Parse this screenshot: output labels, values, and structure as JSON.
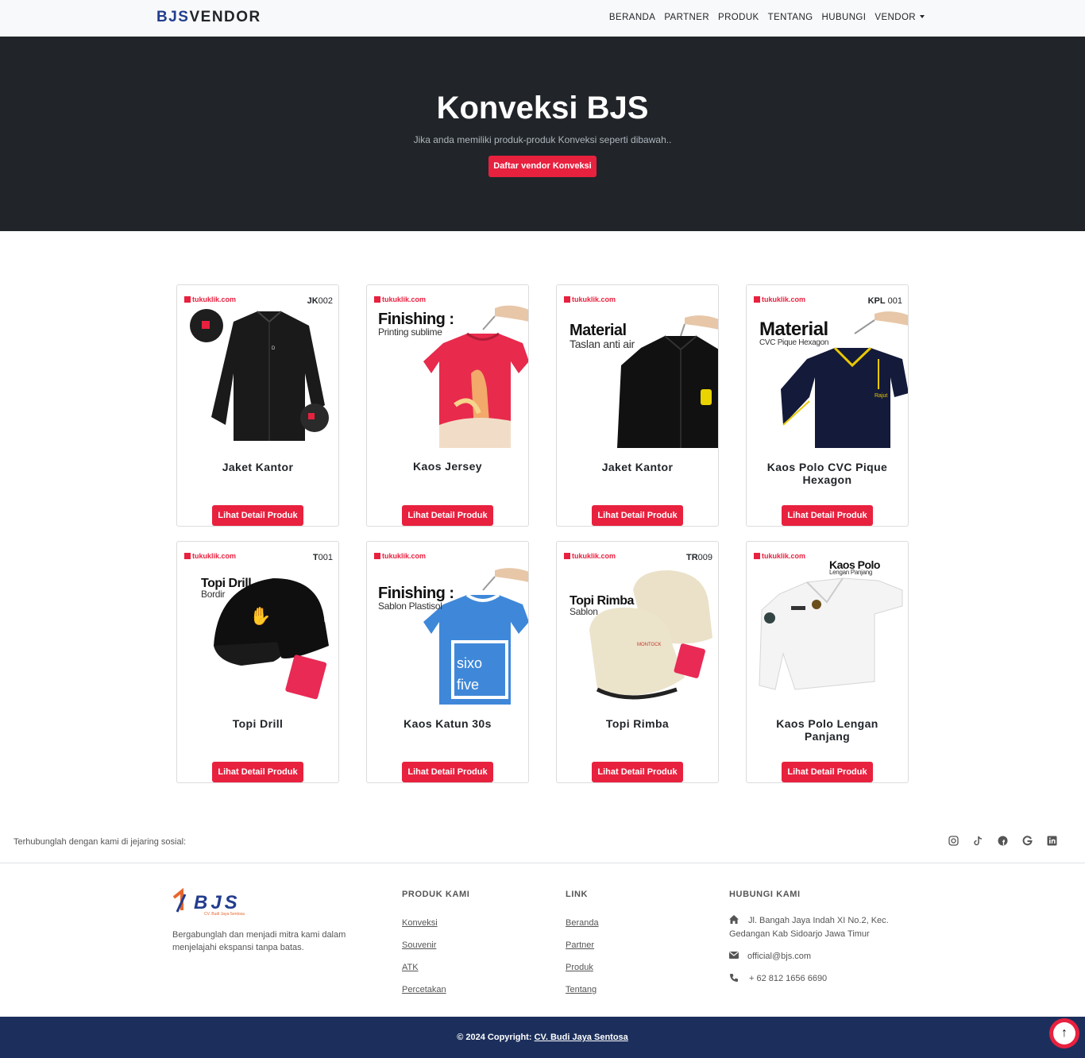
{
  "navbar": {
    "brand_accent": "BJS",
    "brand_rest": "VENDOR",
    "items": [
      "BERANDA",
      "PARTNER",
      "PRODUK",
      "TENTANG",
      "HUBUNGI",
      "VENDOR"
    ]
  },
  "hero": {
    "title": "Konveksi BJS",
    "subtitle": "Jika anda memiliki produk-produk Konveksi seperti dibawah..",
    "button": "Daftar vendor Konveksi"
  },
  "products": [
    {
      "title": "Jaket Kantor",
      "button": "Lihat Detail Produk",
      "store": "tukuklik.com",
      "code_bold": "JK",
      "code_rest": "002",
      "icon": "jacket-icon"
    },
    {
      "title": "Kaos Jersey",
      "button": "Lihat Detail Produk",
      "store": "tukuklik.com",
      "caption_big": "Finishing :",
      "caption_small": "Printing sublime",
      "icon": "tshirt-icon"
    },
    {
      "title": "Jaket Kantor",
      "button": "Lihat Detail Produk",
      "store": "tukuklik.com",
      "caption_big": "Material",
      "caption_small": "Taslan anti air",
      "icon": "jacket-icon"
    },
    {
      "title": "Kaos Polo CVC Pique Hexagon",
      "button": "Lihat Detail Produk",
      "store": "tukuklik.com",
      "code_bold": "KPL",
      "code_rest": "001",
      "caption_big": "Material",
      "caption_small": "CVC Pique Hexagon",
      "icon": "polo-icon"
    },
    {
      "title": "Topi Drill",
      "button": "Lihat Detail Produk",
      "store": "tukuklik.com",
      "code_bold": "T",
      "code_rest": "001",
      "caption_big": "Topi Drill",
      "caption_small": "Bordir",
      "icon": "cap-icon"
    },
    {
      "title": "Kaos Katun 30s",
      "button": "Lihat Detail Produk",
      "store": "tukuklik.com",
      "caption_big": "Finishing :",
      "caption_small": "Sablon Plastisol",
      "icon": "tshirt-icon"
    },
    {
      "title": "Topi Rimba",
      "button": "Lihat Detail Produk",
      "store": "tukuklik.com",
      "code_bold": "TR",
      "code_rest": "009",
      "caption_big": "Topi Rimba",
      "caption_small": "Sablon",
      "icon": "bucket-hat-icon"
    },
    {
      "title": "Kaos Polo Lengan Panjang",
      "button": "Lihat Detail Produk",
      "store": "tukuklik.com",
      "caption_big": "Kaos Polo",
      "caption_small": "Lengan Panjang",
      "icon": "longsleeve-polo-icon"
    }
  ],
  "social": {
    "text": "Terhubunglah dengan kami di jejaring sosial:",
    "icons": [
      "instagram-icon",
      "tiktok-icon",
      "facebook-icon",
      "google-icon",
      "linkedin-icon"
    ]
  },
  "footer": {
    "logo_text": "BJS",
    "logo_sub": "CV. Budi Jaya Sentosa",
    "about": "Bergabunglah dan menjadi mitra kami dalam menjelajahi ekspansi tanpa batas.",
    "produk_title": "PRODUK KAMI",
    "produk_links": [
      "Konveksi",
      "Souvenir",
      "ATK",
      "Percetakan"
    ],
    "link_title": "LINK",
    "link_links": [
      "Beranda",
      "Partner",
      "Produk",
      "Tentang"
    ],
    "contact_title": "HUBUNGI KAMI",
    "address": "Jl. Bangah Jaya Indah XI No.2, Kec. Gedangan Kab Sidoarjo Jawa Timur",
    "email": "official@bjs.com",
    "phone": "+ 62 812 1656 6690"
  },
  "copyright": {
    "text": "© 2024 Copyright: ",
    "company": "CV. Budi Jaya Sentosa"
  },
  "colors": {
    "accent": "#e8213f",
    "brand_blue": "#233d8e",
    "hero_bg": "#212529",
    "footer_bar": "#1c2f5c"
  }
}
